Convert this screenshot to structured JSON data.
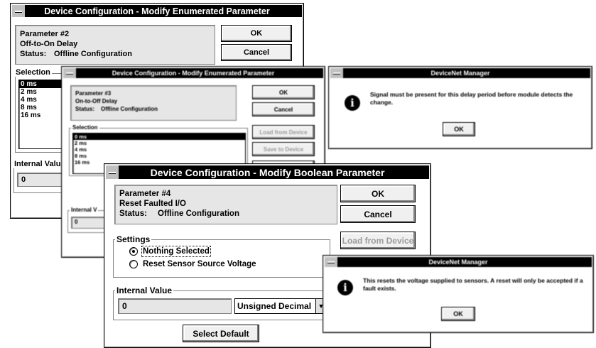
{
  "dialog1": {
    "title": "Device Configuration - Modify Enumerated Parameter",
    "param": "Parameter #2",
    "name": "Off-to-On Delay",
    "status_label": "Status:",
    "status_value": "Offline Configuration",
    "ok": "OK",
    "cancel": "Cancel",
    "selection_label": "Selection",
    "items": [
      "0 ms",
      "2 ms",
      "4 ms",
      "8 ms",
      "16 ms"
    ],
    "internal_label": "Internal Valu",
    "internal_value": "0"
  },
  "dialog2": {
    "title": "Device Configuration - Modify Enumerated Parameter",
    "param": "Parameter #3",
    "name": "On-to-Off Delay",
    "status_label": "Status:",
    "status_value": "Offline Configuration",
    "ok": "OK",
    "cancel": "Cancel",
    "load": "Load from Device",
    "save": "Save to Device",
    "selection_label": "Selection",
    "items": [
      "0 ms",
      "2 ms",
      "4 ms",
      "8 ms",
      "16 ms"
    ],
    "internal_label": "Internal V",
    "internal_value": "0"
  },
  "dialog3": {
    "title": "DeviceNet Manager",
    "message": "Signal must be present for this delay period before module detects the change.",
    "ok": "OK"
  },
  "dialog4": {
    "title": "Device Configuration - Modify Boolean Parameter",
    "param": "Parameter #4",
    "name": "Reset Faulted I/O",
    "status_label": "Status:",
    "status_value": "Offline Configuration",
    "ok": "OK",
    "cancel": "Cancel",
    "load": "Load from Device",
    "settings_label": "Settings",
    "option1": "Nothing Selected",
    "option2": "Reset Sensor Source Voltage",
    "internal_label": "Internal Value",
    "internal_value": "0",
    "format": "Unsigned Decimal",
    "select_default": "Select Default"
  },
  "dialog5": {
    "title": "DeviceNet Manager",
    "message": "This resets the voltage supplied to sensors. A reset will only be accepted if a fault exists.",
    "ok": "OK"
  }
}
